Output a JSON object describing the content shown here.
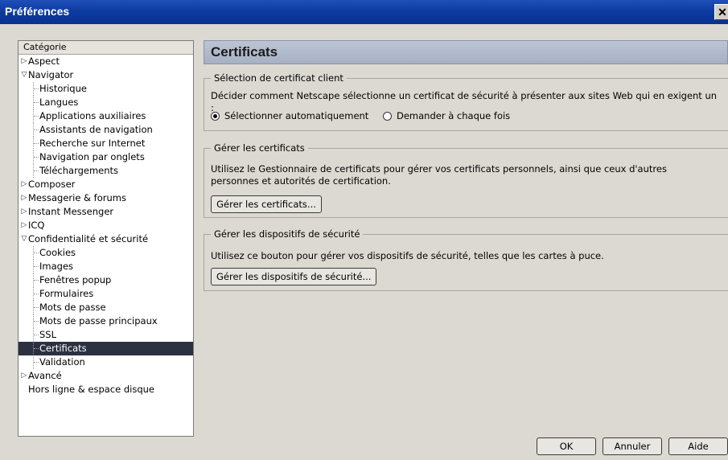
{
  "window": {
    "title": "Préférences",
    "close_glyph": "✕"
  },
  "tree": {
    "header": "Catégorie",
    "items": [
      {
        "label": "Aspect",
        "level": 0,
        "twisty": "closed"
      },
      {
        "label": "Navigator",
        "level": 0,
        "twisty": "open"
      },
      {
        "label": "Historique",
        "level": 1
      },
      {
        "label": "Langues",
        "level": 1
      },
      {
        "label": "Applications auxiliaires",
        "level": 1
      },
      {
        "label": "Assistants de navigation",
        "level": 1
      },
      {
        "label": "Recherche sur Internet",
        "level": 1
      },
      {
        "label": "Navigation par onglets",
        "level": 1
      },
      {
        "label": "Téléchargements",
        "level": 1
      },
      {
        "label": "Composer",
        "level": 0,
        "twisty": "closed"
      },
      {
        "label": "Messagerie & forums",
        "level": 0,
        "twisty": "closed"
      },
      {
        "label": "Instant Messenger",
        "level": 0,
        "twisty": "closed"
      },
      {
        "label": "ICQ",
        "level": 0,
        "twisty": "closed"
      },
      {
        "label": "Confidentialité et sécurité",
        "level": 0,
        "twisty": "open"
      },
      {
        "label": "Cookies",
        "level": 1
      },
      {
        "label": "Images",
        "level": 1
      },
      {
        "label": "Fenêtres popup",
        "level": 1
      },
      {
        "label": "Formulaires",
        "level": 1
      },
      {
        "label": "Mots de passe",
        "level": 1
      },
      {
        "label": "Mots de passe principaux",
        "level": 1
      },
      {
        "label": "SSL",
        "level": 1
      },
      {
        "label": "Certificats",
        "level": 1,
        "selected": true
      },
      {
        "label": "Validation",
        "level": 1
      },
      {
        "label": "Avancé",
        "level": 0,
        "twisty": "closed"
      },
      {
        "label": "Hors ligne & espace disque",
        "level": 0,
        "twisty": "none"
      }
    ]
  },
  "panel": {
    "title": "Certificats",
    "client_selection": {
      "legend": "Sélection de certificat client",
      "description": "Décider comment Netscape sélectionne un certificat de sécurité à présenter aux sites Web qui en exigent un :",
      "option_auto": "Sélectionner automatiquement",
      "option_ask": "Demander à chaque fois",
      "selected": "auto"
    },
    "manage_certs": {
      "legend": "Gérer les certificats",
      "description": "Utilisez le Gestionnaire de certificats pour gérer vos certificats personnels, ainsi que ceux d'autres personnes et autorités de certification.",
      "button": "Gérer les certificats..."
    },
    "manage_devices": {
      "legend": "Gérer les dispositifs de sécurité",
      "description": "Utilisez ce bouton pour gérer vos dispositifs de sécurité, telles que les cartes à puce.",
      "button": "Gérer les dispositifs de sécurité..."
    }
  },
  "footer": {
    "ok": "OK",
    "cancel": "Annuler",
    "help": "Aide"
  }
}
